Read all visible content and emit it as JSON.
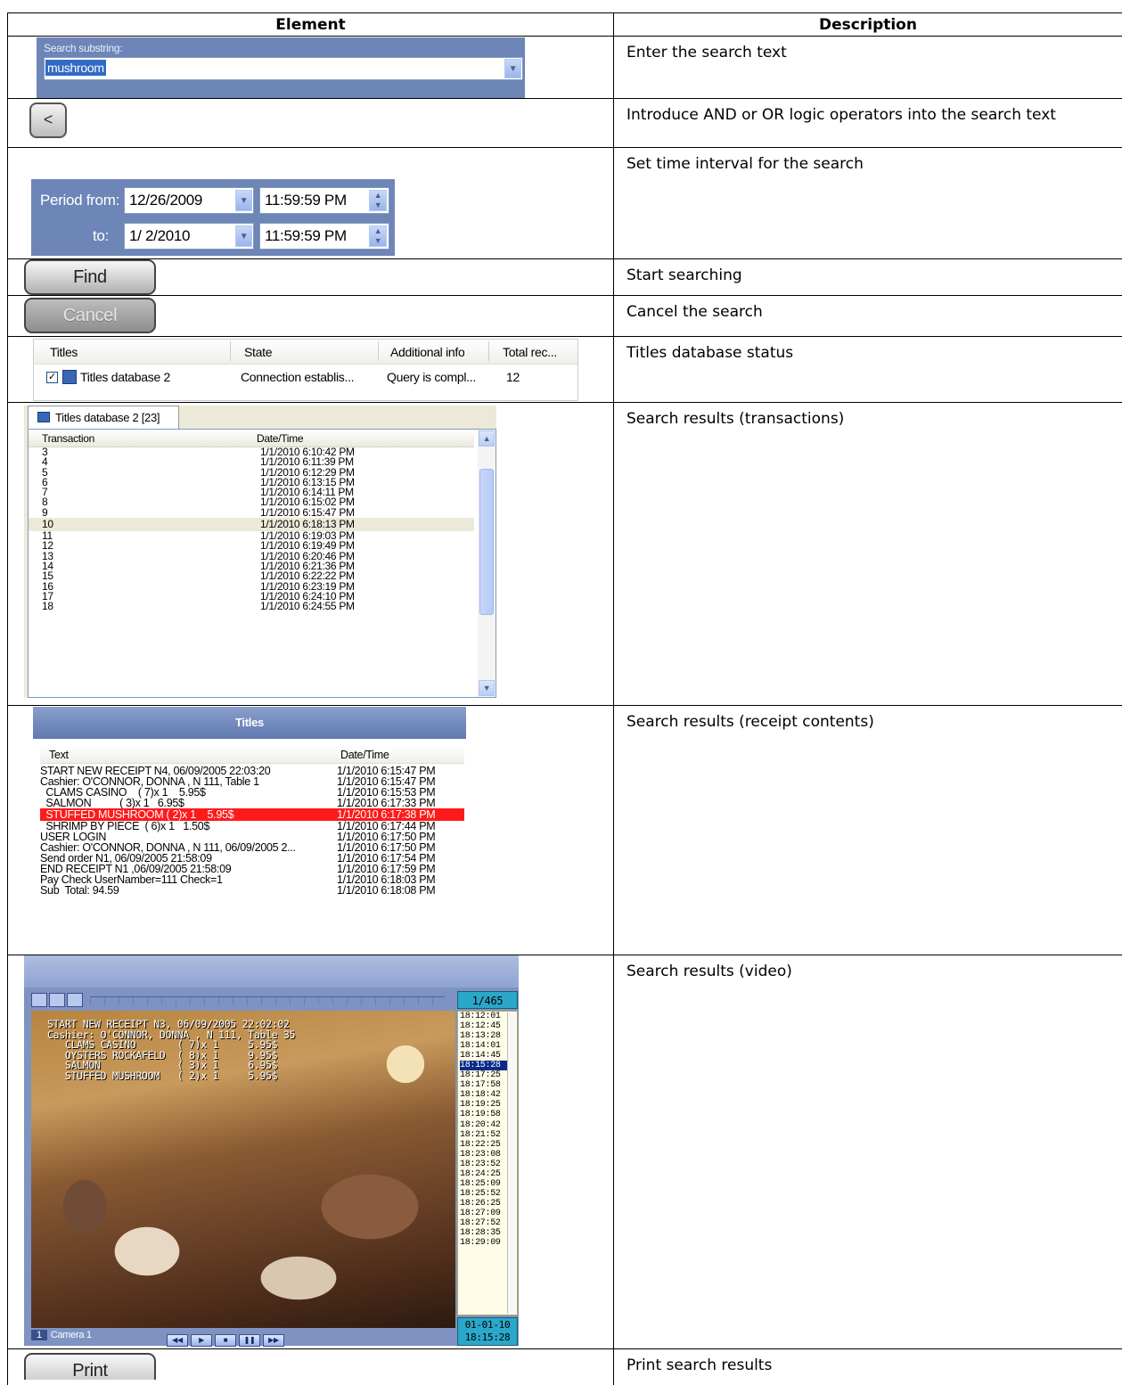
{
  "headers": {
    "element": "Element",
    "description": "Description"
  },
  "rows": {
    "search": {
      "label": "Search substring:",
      "value": "mushroom",
      "description": "Enter the search text"
    },
    "logic": {
      "glyph": "<",
      "description": "Introduce AND or OR logic operators into the search text"
    },
    "period": {
      "from_label": "Period from:",
      "to_label": "to:",
      "from_date": "12/26/2009",
      "from_time": "11:59:59 PM",
      "to_date": "1/ 2/2010",
      "to_time": "11:59:59 PM",
      "description": "Set time interval for the search"
    },
    "find": {
      "label": "Find",
      "description": "Start searching"
    },
    "cancel": {
      "label": "Cancel",
      "description": "Cancel the search"
    },
    "dbstatus": {
      "columns": [
        "Titles",
        "State",
        "Additional info",
        "Total rec..."
      ],
      "row": {
        "name": "Titles database 2",
        "state": "Connection establis...",
        "info": "Query is compl...",
        "total": "12"
      },
      "description": "Titles database status"
    },
    "transactions": {
      "tab": "Titles database 2 [23]",
      "columns": [
        "Transaction",
        "Date/Time"
      ],
      "items": [
        [
          "3",
          "1/1/2010 6:10:42 PM"
        ],
        [
          "4",
          "1/1/2010 6:11:39 PM"
        ],
        [
          "5",
          "1/1/2010 6:12:29 PM"
        ],
        [
          "6",
          "1/1/2010 6:13:15 PM"
        ],
        [
          "7",
          "1/1/2010 6:14:11 PM"
        ],
        [
          "8",
          "1/1/2010 6:15:02 PM"
        ],
        [
          "9",
          "1/1/2010 6:15:47 PM"
        ],
        [
          "10",
          "1/1/2010 6:18:13 PM"
        ],
        [
          "11",
          "1/1/2010 6:19:03 PM"
        ],
        [
          "12",
          "1/1/2010 6:19:49 PM"
        ],
        [
          "13",
          "1/1/2010 6:20:46 PM"
        ],
        [
          "14",
          "1/1/2010 6:21:36 PM"
        ],
        [
          "15",
          "1/1/2010 6:22:22 PM"
        ],
        [
          "16",
          "1/1/2010 6:23:19 PM"
        ],
        [
          "17",
          "1/1/2010 6:24:10 PM"
        ],
        [
          "18",
          "1/1/2010 6:24:55 PM"
        ]
      ],
      "selected": "10",
      "description": "Search results (transactions)"
    },
    "receipt": {
      "title": "Titles",
      "columns": [
        "Text",
        "Date/Time"
      ],
      "items": [
        [
          "START NEW RECEIPT N4, 06/09/2005 22:03:20",
          "1/1/2010 6:15:47 PM"
        ],
        [
          "Cashier: O'CONNOR, DONNA , N 111, Table 1",
          "1/1/2010 6:15:47 PM"
        ],
        [
          "  CLAMS CASINO    ( 7)x 1    5.95$",
          "1/1/2010 6:15:53 PM"
        ],
        [
          "  SALMON          ( 3)x 1   6.95$",
          "1/1/2010 6:17:33 PM"
        ],
        [
          "  STUFFED MUSHROOM ( 2)x 1    5.95$",
          "1/1/2010 6:17:38 PM"
        ],
        [
          "  SHRIMP BY PIECE  ( 6)x 1   1.50$",
          "1/1/2010 6:17:44 PM"
        ],
        [
          "USER LOGIN",
          "1/1/2010 6:17:50 PM"
        ],
        [
          "Cashier: O'CONNOR, DONNA , N 111, 06/09/2005 2...",
          "1/1/2010 6:17:50 PM"
        ],
        [
          "Send order N1, 06/09/2005 21:58:09",
          "1/1/2010 6:17:54 PM"
        ],
        [
          "END RECEIPT N1 ,06/09/2005 21:58:09",
          "1/1/2010 6:17:59 PM"
        ],
        [
          "Pay Check UserNamber=111 Check=1",
          "1/1/2010 6:18:03 PM"
        ],
        [
          "Sub  Total: 94.59",
          "1/1/2010 6:18:08 PM"
        ]
      ],
      "highlighted_index": 4,
      "description": "Search results (receipt contents)"
    },
    "video": {
      "frame_count": "1/465",
      "overlay": "START NEW RECEIPT N3, 06/09/2005 22:02:02\nCashier: O'CONNOR, DONNA , N 111, Table 35\n   CLAMS CASINO       ( 7)x 1     5.95$\n   OYSTERS ROCKAFELD  ( 8)x 1     9.95$\n   SALMON             ( 3)x 1     6.95$\n   STUFFED MUSHROOM   ( 2)x 1     5.95$",
      "camera_num": "1",
      "camera_label": "Camera 1",
      "times": [
        "18:12:01",
        "18:12:45",
        "18:13:28",
        "18:14:01",
        "18:14:45",
        "18:15:28",
        "18:17:25",
        "18:17:58",
        "18:18:42",
        "18:19:25",
        "18:19:58",
        "18:20:42",
        "18:21:52",
        "18:22:25",
        "18:23:08",
        "18:23:52",
        "18:24:25",
        "18:25:09",
        "18:25:52",
        "18:26:25",
        "18:27:09",
        "18:27:52",
        "18:28:35",
        "18:29:09"
      ],
      "selected_time": "18:15:28",
      "date": "01-01-10",
      "time": "18:15:28",
      "description": "Search results (video)"
    },
    "print": {
      "label": "Print",
      "description": "Print search results"
    }
  }
}
